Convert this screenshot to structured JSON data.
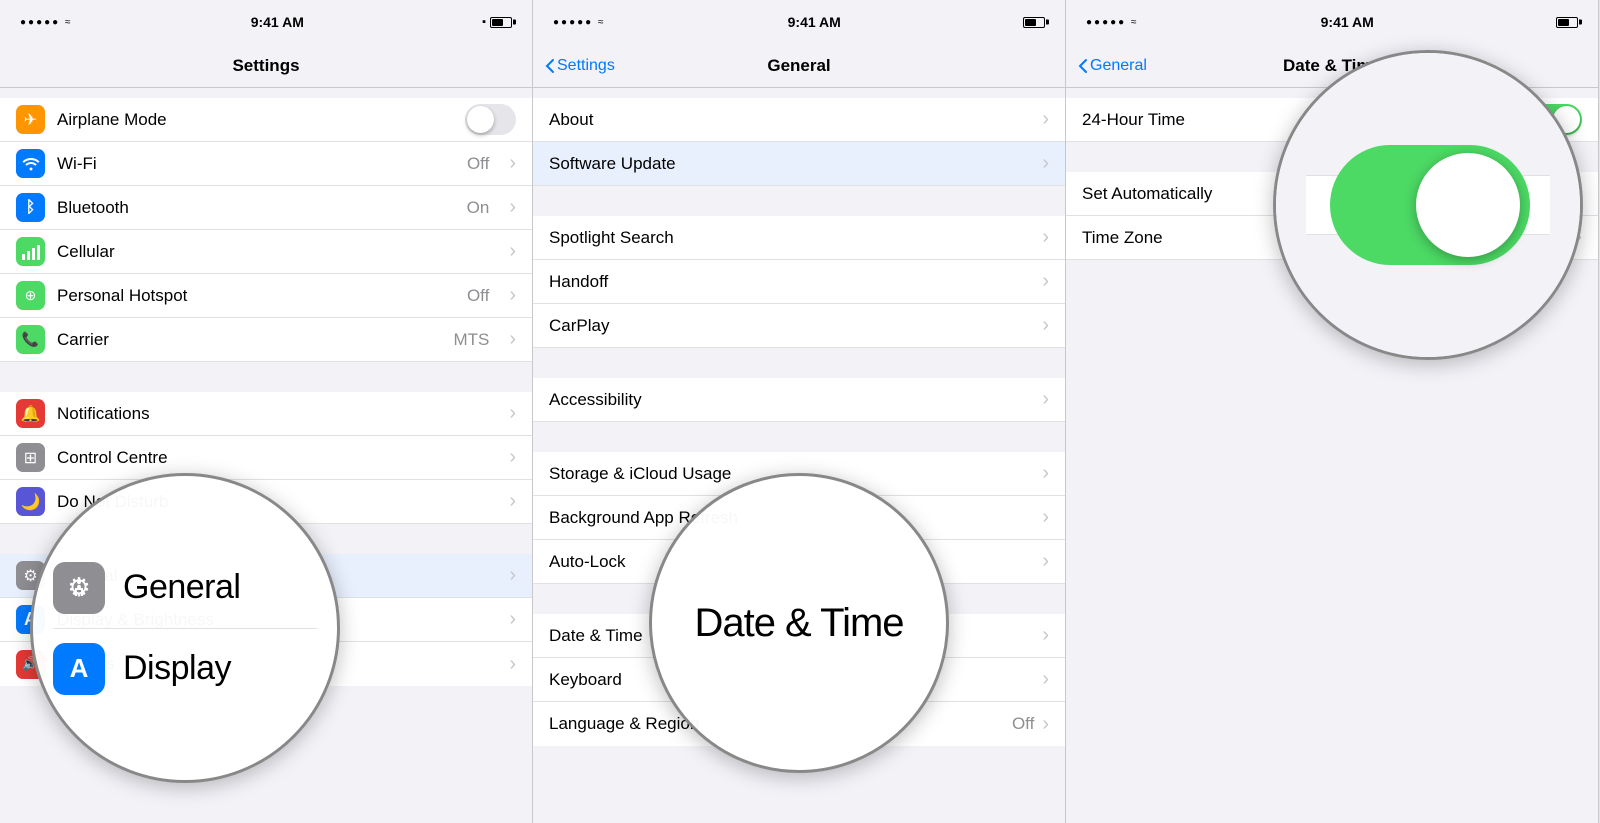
{
  "panels": [
    {
      "id": "settings",
      "statusBar": {
        "dots": "•••••",
        "wifi": true,
        "time": "9:41 AM",
        "battery": "medium"
      },
      "navTitle": "Settings",
      "rows": [
        {
          "icon": "airplane",
          "iconBg": "orange",
          "label": "Airplane Mode",
          "value": "",
          "toggle": "off",
          "showToggle": true
        },
        {
          "icon": "wifi",
          "iconBg": "blue",
          "label": "Wi-Fi",
          "value": "Off",
          "toggle": null,
          "showToggle": false
        },
        {
          "icon": "bluetooth",
          "iconBg": "blue",
          "label": "Bluetooth",
          "value": "On",
          "toggle": null,
          "showToggle": false
        },
        {
          "icon": "cellular",
          "iconBg": "green",
          "label": "Cellular",
          "value": "",
          "toggle": null,
          "showToggle": false
        },
        {
          "icon": "hotspot",
          "iconBg": "green",
          "label": "Personal Hotspot",
          "value": "Off",
          "toggle": null,
          "showToggle": false
        },
        {
          "icon": "carrier",
          "iconBg": "green",
          "label": "Carrier",
          "value": "MTS",
          "toggle": null,
          "showToggle": false
        }
      ],
      "extraRows": [
        {
          "label": ""
        },
        {
          "label": ""
        },
        {
          "label": "General"
        },
        {
          "label": ""
        },
        {
          "label": "Display"
        },
        {
          "label": "Sounds"
        }
      ],
      "zoomRows": [
        {
          "label": "General",
          "iconBg": "gray",
          "icon": "gear"
        },
        {
          "label": "Display",
          "iconBg": "blue",
          "icon": "A",
          "partial": true
        }
      ]
    },
    {
      "id": "general",
      "statusBar": {
        "dots": "•••••",
        "wifi": true,
        "time": "9:41 AM",
        "battery": "medium"
      },
      "navTitle": "General",
      "navBack": "Settings",
      "rows": [
        {
          "label": "About"
        },
        {
          "label": "Software Update",
          "highlighted": true
        },
        {
          "label": ""
        },
        {
          "label": "Spotlight Search"
        },
        {
          "label": "Handoff"
        },
        {
          "label": "CarPlay"
        },
        {
          "label": ""
        },
        {
          "label": "Accessibility"
        },
        {
          "label": ""
        },
        {
          "label": ""
        },
        {
          "label": ""
        },
        {
          "label": ""
        },
        {
          "label": ""
        },
        {
          "label": "Date & Time",
          "zoomTarget": true
        },
        {
          "label": ""
        },
        {
          "label": ""
        }
      ]
    },
    {
      "id": "datetime",
      "statusBar": {
        "dots": "•••••",
        "wifi": true,
        "time": "9:41 AM",
        "battery": "medium"
      },
      "navTitle": "Date & Time",
      "navBack": "General",
      "rows": [
        {
          "label": "24-Hour Time",
          "toggle": "on"
        },
        {
          "label": ""
        },
        {
          "label": "Set Automatically",
          "toggle": "on"
        },
        {
          "label": "Time Zone"
        }
      ]
    }
  ],
  "icons": {
    "airplane": "✈",
    "wifi": "📶",
    "bluetooth": "🔵",
    "cellular": "📡",
    "hotspot": "🔗",
    "carrier": "📞",
    "gear": "⚙",
    "A": "A"
  },
  "colors": {
    "orange": "#ff9500",
    "blue": "#007aff",
    "green": "#4cd964",
    "gray": "#8e8e93",
    "toggleOff": "#e5e5ea",
    "toggleOn": "#4cd964"
  }
}
